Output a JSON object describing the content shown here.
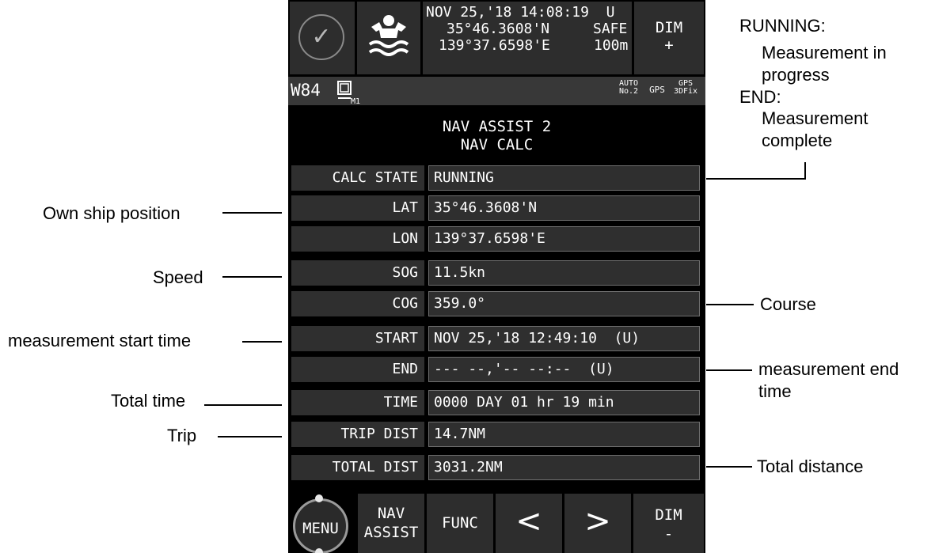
{
  "header": {
    "datetime": "NOV 25,'18 14:08:19  U",
    "lat": "35°46.3608'N",
    "lon": "139°37.6598'E",
    "safe_label": "SAFE",
    "safe_value": "100m",
    "dim_plus": {
      "line1": "DIM",
      "line2": "+"
    }
  },
  "subbar": {
    "mode": "W84",
    "mode_sub": "M1",
    "auto_top": "AUTO",
    "auto_bottom": "No.2",
    "gps": "GPS",
    "gps_fix_top": "GPS",
    "gps_fix_bottom": "3DFix"
  },
  "title": {
    "line1": "NAV ASSIST 2",
    "line2": "NAV CALC"
  },
  "rows": [
    {
      "label": "CALC STATE",
      "value": "RUNNING"
    },
    {
      "label": "LAT",
      "value": "35°46.3608'N"
    },
    {
      "label": "LON",
      "value": "139°37.6598'E"
    },
    {
      "label": "SOG",
      "value": "11.5kn"
    },
    {
      "label": "COG",
      "value": "359.0°"
    },
    {
      "label": "START",
      "value": "NOV 25,'18 12:49:10  (U)"
    },
    {
      "label": "END",
      "value": "--- --,'-- --:--  (U)"
    },
    {
      "label": "TIME",
      "value": "0000 DAY 01 hr 19 min"
    },
    {
      "label": "TRIP DIST",
      "value": "14.7NM"
    },
    {
      "label": "TOTAL DIST",
      "value": "3031.2NM"
    }
  ],
  "bottom": {
    "menu": "MENU",
    "nav_assist": {
      "line1": "NAV",
      "line2": "ASSIST"
    },
    "func": "FUNC",
    "prev": "<",
    "next": ">",
    "dim_minus": {
      "line1": "DIM",
      "line2": "-"
    }
  },
  "annotations": {
    "running": "RUNNING:",
    "running_desc1": "Measurement in",
    "running_desc2": "progress",
    "end": "END:",
    "end_desc1": "Measurement",
    "end_desc2": "complete",
    "own_ship": "Own ship position",
    "speed": "Speed",
    "course": "Course",
    "start_time": "measurement start time",
    "end_time1": "measurement end",
    "end_time2": "time",
    "total_time": "Total time",
    "trip": "Trip",
    "total_distance": "Total distance"
  }
}
